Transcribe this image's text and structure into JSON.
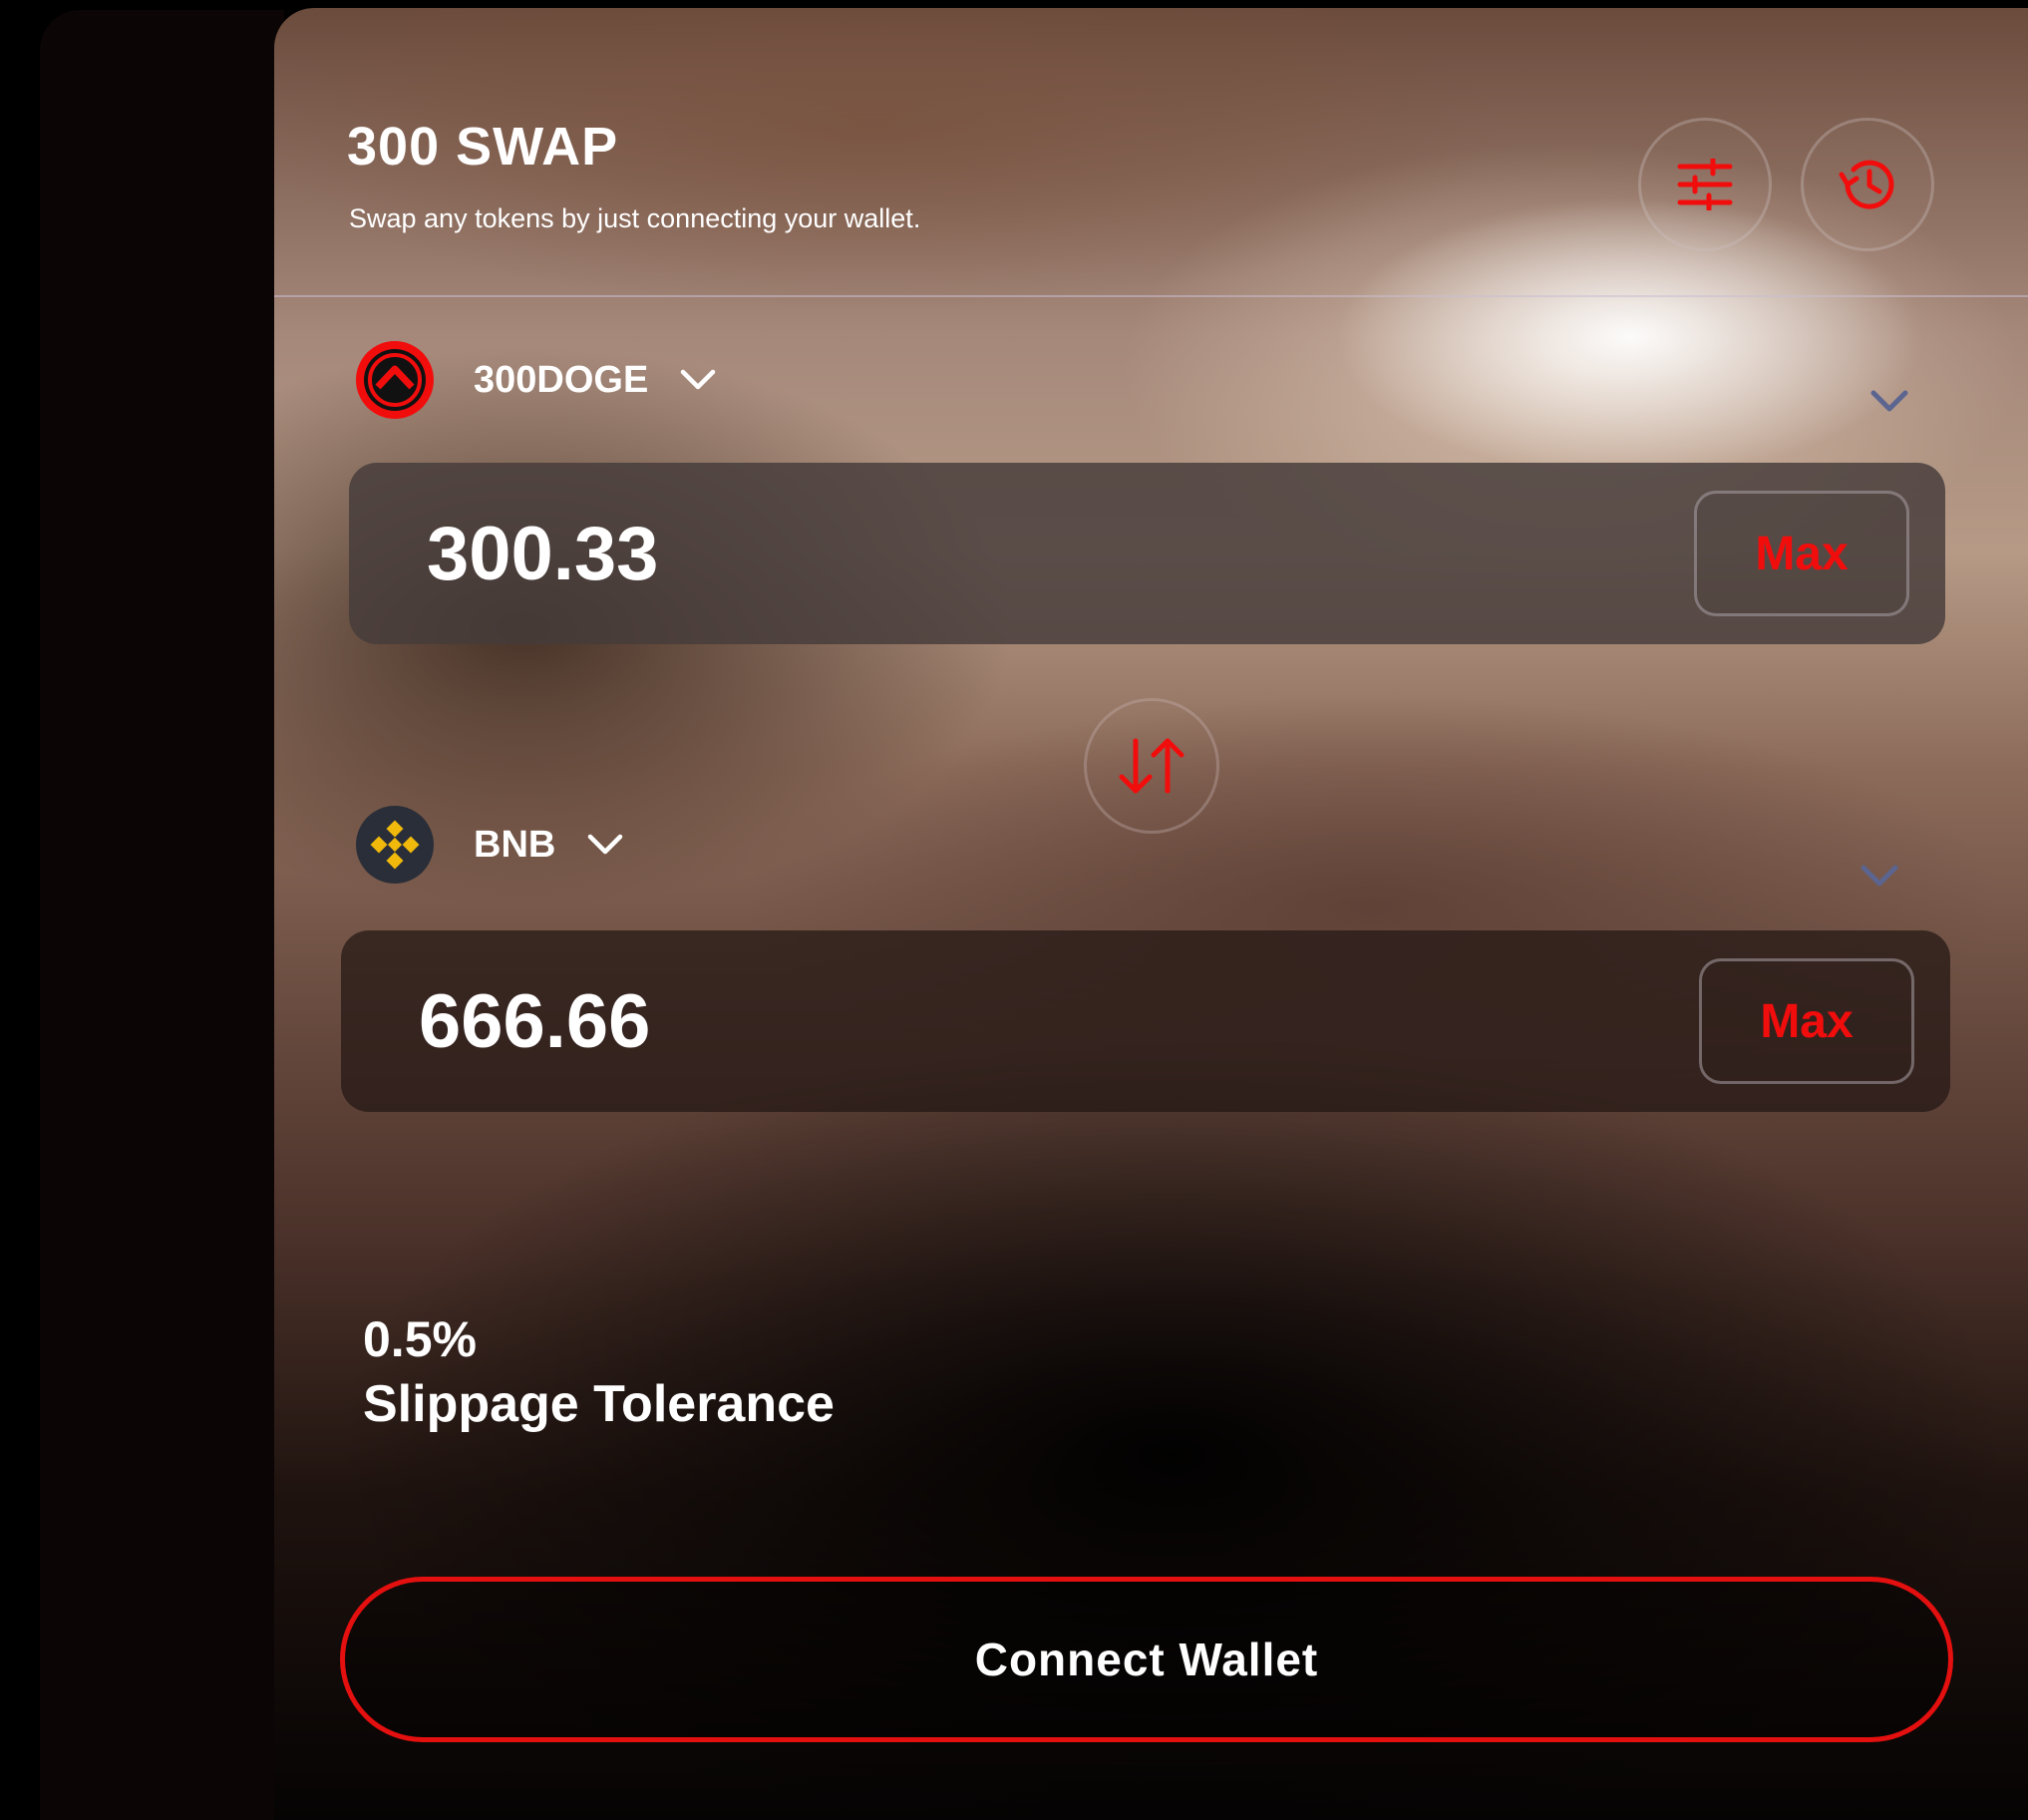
{
  "header": {
    "title": "300 SWAP",
    "subtitle": "Swap any tokens by just connecting your wallet."
  },
  "icons": {
    "settings": "sliders-icon",
    "history": "history-icon",
    "swap": "swap-arrows-icon",
    "dropdown": "chevron-down-icon"
  },
  "from_token": {
    "symbol": "300DOGE",
    "amount": "300.33",
    "max_label": "Max"
  },
  "to_token": {
    "symbol": "BNB",
    "amount": "666.66",
    "max_label": "Max"
  },
  "slippage": {
    "value": "0.5%",
    "label": "Slippage Tolerance"
  },
  "connect": {
    "label": "Connect Wallet"
  },
  "colors": {
    "accent": "#f20d0d",
    "chevron_side": "#5b6590",
    "bnb_yellow": "#f0b90b"
  }
}
